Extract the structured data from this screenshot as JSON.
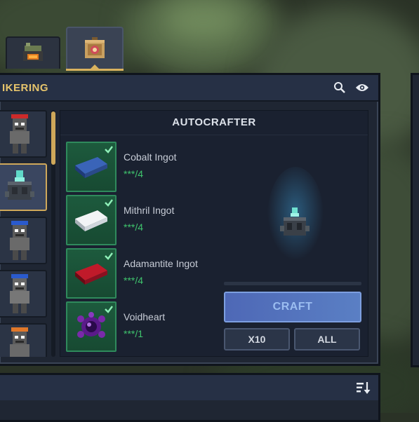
{
  "panel": {
    "title": "IKERING"
  },
  "station": {
    "title": "AUTOCRAFTER"
  },
  "ingredients": [
    {
      "name": "Cobalt Ingot",
      "count": "***/4",
      "color": "#2a4a8a"
    },
    {
      "name": "Mithril Ingot",
      "count": "***/4",
      "color": "#d8dde2"
    },
    {
      "name": "Adamantite Ingot",
      "count": "***/4",
      "color": "#8a1020"
    },
    {
      "name": "Voidheart",
      "count": "***/1",
      "color": "#6a2a9a"
    }
  ],
  "buttons": {
    "craft": "CRAFT",
    "x10": "X10",
    "all": "ALL"
  },
  "icons": {
    "search": "search-icon",
    "eye": "eye-icon",
    "sort": "sort-icon",
    "check": "check-icon"
  },
  "colors": {
    "accent_gold": "#e6c46c",
    "ingredient_ok": "#3fc46d",
    "craft_button": "#5a7fc4"
  }
}
